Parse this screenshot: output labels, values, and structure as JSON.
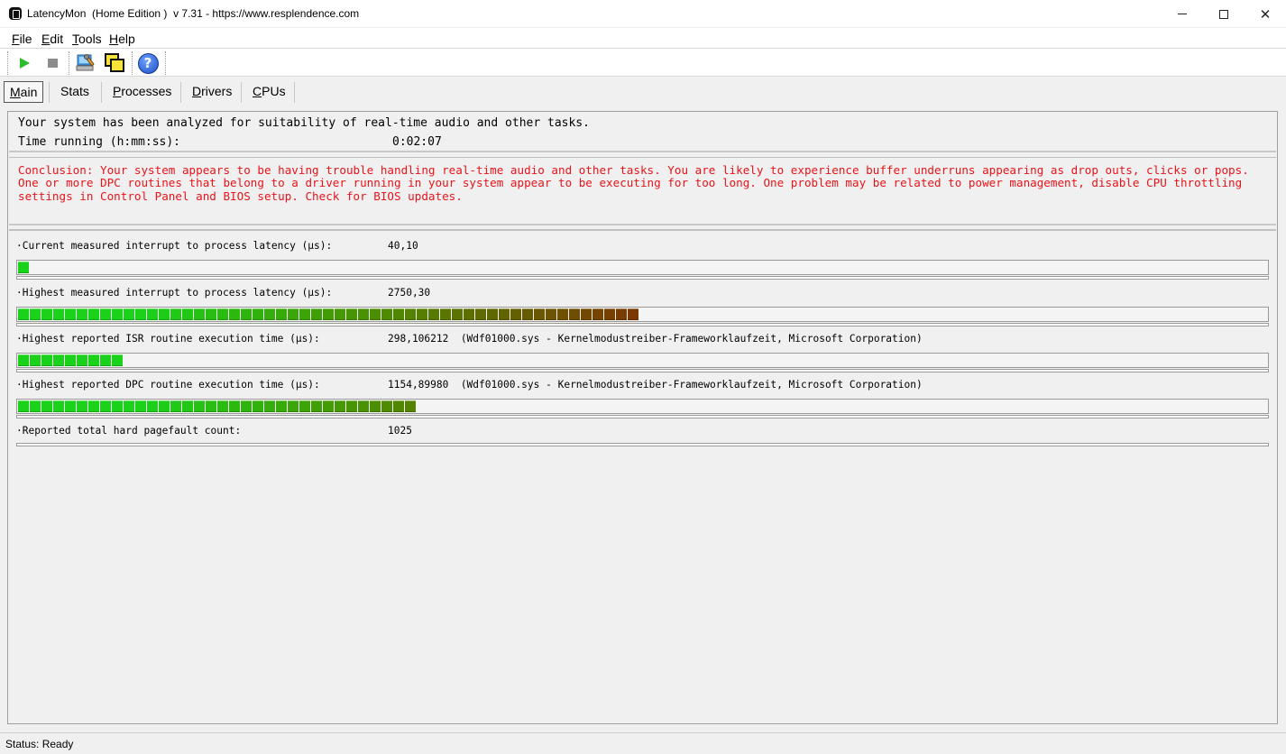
{
  "window": {
    "title": "LatencyMon  (Home Edition )  v 7.31 - https://www.resplendence.com",
    "minimize_glyph": "",
    "close_glyph": "✕"
  },
  "menu": [
    {
      "label": "File",
      "hotkey": "F",
      "rest": "ile"
    },
    {
      "label": "Edit",
      "hotkey": "E",
      "rest": "dit"
    },
    {
      "label": "Tools",
      "hotkey": "T",
      "rest": "ools"
    },
    {
      "label": "Help",
      "hotkey": "H",
      "rest": "elp"
    }
  ],
  "toolbar": {
    "icons": [
      "play-icon",
      "stop-icon",
      "computer-wrench-icon",
      "windows-icon",
      "help-icon"
    ],
    "help_glyph": "?"
  },
  "tabs": [
    {
      "label": "Main",
      "hotkey": "M",
      "rest": "ain",
      "active": true
    },
    {
      "label": "Stats",
      "hotkey": "",
      "rest": "Stats",
      "active": false
    },
    {
      "label": "Processes",
      "hotkey": "P",
      "rest": "rocesses",
      "active": false
    },
    {
      "label": "Drivers",
      "hotkey": "D",
      "rest": "rivers",
      "active": false
    },
    {
      "label": "CPUs",
      "hotkey": "C",
      "rest": "PUs",
      "active": false
    }
  ],
  "summary": {
    "analyzed": "Your system has been analyzed for suitability of real-time audio and other tasks.",
    "time_label": "Time running (h:mm:ss):",
    "time_value": "0:02:07"
  },
  "conclusion": "Conclusion: Your system appears to be having trouble handling real-time audio and other tasks. You are likely to experience buffer underruns appearing as drop outs, clicks or pops. One or more DPC routines that belong to a driver running in your system appear to be executing for too long. One problem may be related to power management, disable CPU throttling settings in Control Panel and BIOS setup. Check for BIOS updates.",
  "metrics": [
    {
      "label": "·Current measured interrupt to process latency (µs):",
      "value": "40,10",
      "segments": 1
    },
    {
      "label": "·Highest measured interrupt to process latency (µs):",
      "value": "2750,30",
      "segments": 53
    },
    {
      "label": "·Highest reported ISR routine execution time (µs):",
      "value": "298,106212  (Wdf01000.sys - Kernelmodustreiber-Frameworklaufzeit, Microsoft Corporation)",
      "segments": 9
    },
    {
      "label": "·Highest reported DPC routine execution time (µs):",
      "value": "1154,89980  (Wdf01000.sys - Kernelmodustreiber-Frameworklaufzeit, Microsoft Corporation)",
      "segments": 34
    },
    {
      "label": "·Reported total hard pagefault count:",
      "value": "1025",
      "segments": 0
    }
  ],
  "colors": {
    "green": "#19d219",
    "mid": "#4f8a00",
    "red_brown": "#7a3800",
    "conclusion_text": "#e8141a"
  },
  "status": "Status: Ready"
}
